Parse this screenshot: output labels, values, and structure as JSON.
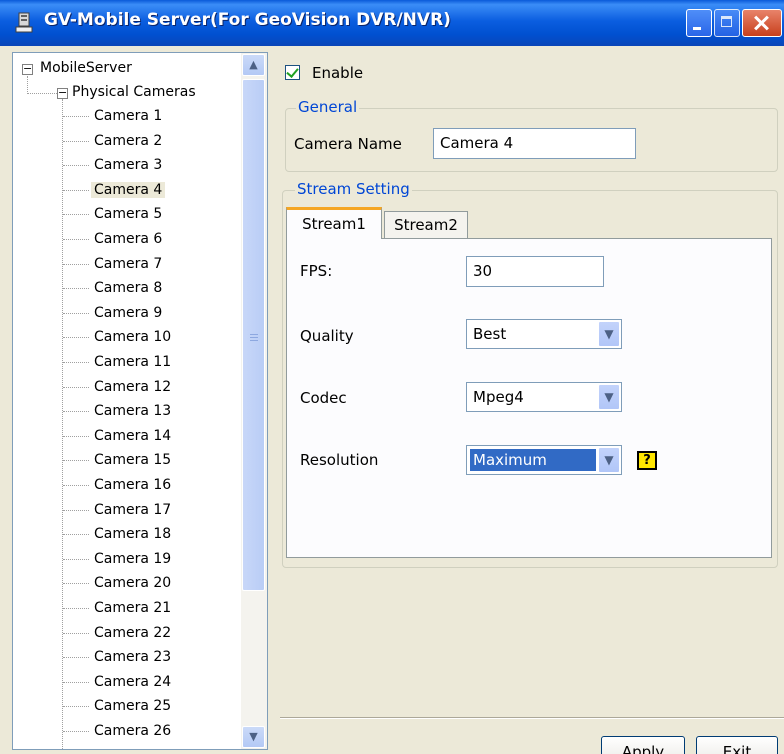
{
  "window": {
    "title": "GV-Mobile Server(For GeoVision DVR/NVR)"
  },
  "tree": {
    "root": "MobileServer",
    "group": "Physical Cameras",
    "selected": "Camera 4",
    "cameras": [
      "Camera 1",
      "Camera 2",
      "Camera 3",
      "Camera 4",
      "Camera 5",
      "Camera 6",
      "Camera 7",
      "Camera 8",
      "Camera 9",
      "Camera 10",
      "Camera 11",
      "Camera 12",
      "Camera 13",
      "Camera 14",
      "Camera 15",
      "Camera 16",
      "Camera 17",
      "Camera 18",
      "Camera 19",
      "Camera 20",
      "Camera 21",
      "Camera 22",
      "Camera 23",
      "Camera 24",
      "Camera 25",
      "Camera 26"
    ]
  },
  "enable": {
    "label": "Enable",
    "checked": true
  },
  "general": {
    "legend": "General",
    "camera_name_label": "Camera Name",
    "camera_name_value": "Camera 4"
  },
  "stream": {
    "legend": "Stream Setting",
    "tabs": [
      "Stream1",
      "Stream2"
    ],
    "active_tab": "Stream1",
    "fps_label": "FPS:",
    "fps_value": "30",
    "quality_label": "Quality",
    "quality_value": "Best",
    "codec_label": "Codec",
    "codec_value": "Mpeg4",
    "resolution_label": "Resolution",
    "resolution_value": "Maximum",
    "help_glyph": "?"
  },
  "buttons": {
    "apply": "Apply",
    "exit": "Exit"
  },
  "icons": {
    "app": "server-icon",
    "dropdown": "chevron-down-icon",
    "help": "help-icon"
  },
  "colors": {
    "titlebar": "#0b5ee0",
    "accent": "#0046d5",
    "selection": "#316ac5",
    "tab_highlight": "#f5a623",
    "help_bg": "#ffe600"
  }
}
